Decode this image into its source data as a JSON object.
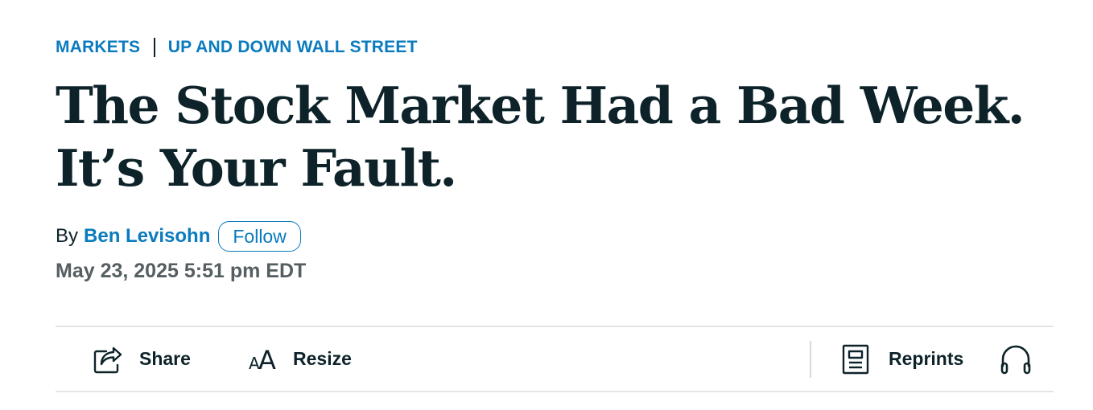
{
  "breadcrumb": {
    "section": "MARKETS",
    "column": "UP AND DOWN WALL STREET"
  },
  "headline": {
    "line1": "The Stock Market Had a Bad Week.",
    "line2": "It’s Your Fault."
  },
  "byline": {
    "prefix": "By",
    "author": "Ben Levisohn",
    "follow_label": "Follow"
  },
  "timestamp": "May 23, 2025 5:51 pm EDT",
  "toolbar": {
    "share_label": "Share",
    "share_icon": "share-icon",
    "resize_label": "Resize",
    "resize_icon": "text-size-icon",
    "resize_glyph_small": "A",
    "resize_glyph_large": "A",
    "reprints_label": "Reprints",
    "reprints_icon": "document-icon",
    "listen_icon": "headphones-icon"
  },
  "colors": {
    "accent": "#0a7bbe",
    "text": "#0d2329",
    "muted": "#555e61",
    "divider": "#e3e5e6"
  }
}
